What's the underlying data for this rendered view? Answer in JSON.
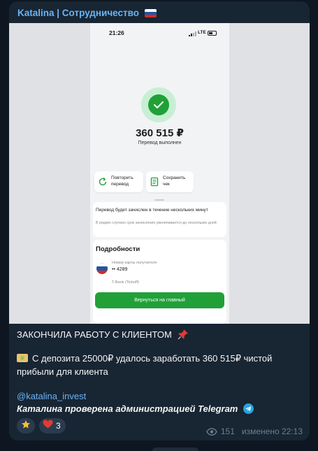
{
  "channel": {
    "title": "Katalina | Сотрудничество",
    "flag_icon": "russia-flag-icon"
  },
  "screenshot": {
    "time": "21:26",
    "network": "LTE",
    "amount": "360 515 ₽",
    "status": "Перевод выполнен",
    "buttons": [
      {
        "label_line1": "Повторить",
        "label_line2": "перевод",
        "icon": "repeat-icon"
      },
      {
        "label_line1": "Сохранить",
        "label_line2": "чек",
        "icon": "receipt-icon"
      }
    ],
    "notice": "Перевод будет зачислен в течение нескольких минут",
    "notice_sub": "В редких случаях срок зачисления увеличивается до нескольких дней",
    "details_title": "Подробности",
    "card_label": "Номер карты получателя",
    "card_number": "•• 4289",
    "bank": "T-Bank (Tinkoff)",
    "home_button": "Вернуться на главный"
  },
  "post": {
    "title": "ЗАКОНЧИЛА РАБОТУ С КЛИЕНТОМ",
    "body_line1": "С депозита 25000₽ удалось заработать 360 515₽ чистой",
    "body_line2": "прибыли для клиента",
    "handle": "@katalina_invest",
    "verified_text": "Каталина проверена администрацией Telegram"
  },
  "reactions": [
    {
      "icon": "star-icon",
      "count": ""
    },
    {
      "icon": "heart-icon",
      "count": "3"
    }
  ],
  "meta": {
    "views": "151",
    "edited": "изменено 22:13"
  },
  "colors": {
    "background": "#0e1621",
    "bubble": "#182533",
    "accent": "#6ab3f3",
    "sber_green": "#21a038"
  }
}
